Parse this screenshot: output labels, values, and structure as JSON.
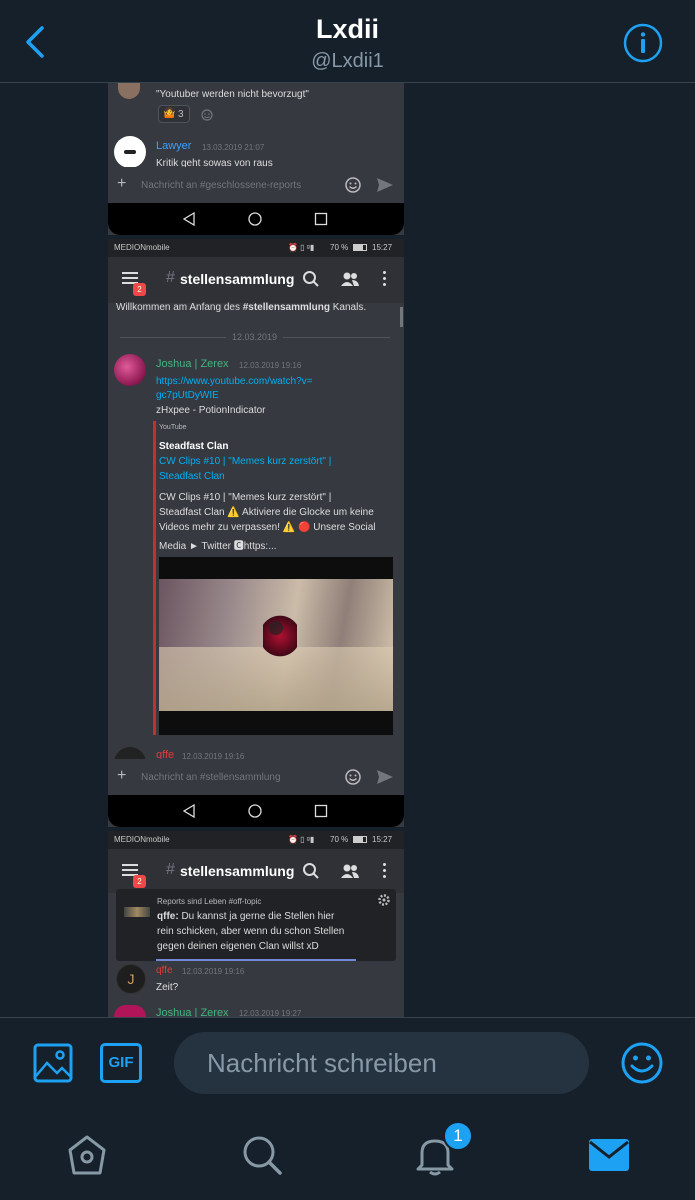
{
  "header": {
    "title": "Lxdii",
    "handle": "@Lxdii1"
  },
  "shot": {
    "top": {
      "quote": "\"Youtuber werden nicht bevorzugt\"",
      "reaction_count": "3",
      "user": "Lawyer",
      "time": "13.03.2019 21:07",
      "text": "Kritik geht sowas von raus",
      "input_placeholder": "Nachricht an #geschlossene-reports"
    },
    "status1": {
      "carrier": "MEDIONmobile",
      "battery": "70 %",
      "time": "15:27"
    },
    "channel1": {
      "name": "stellensammlung",
      "badge": "2",
      "welcome_pre": "Willkommen am Anfang des ",
      "welcome_channel": "#stellensammlung",
      "welcome_post": " Kanals.",
      "date_divider": "12.03.2019",
      "user": "Joshua | Zerex",
      "time": "12.03.2019 19:16",
      "link1": "https://www.youtube.com/watch?v=",
      "link2": "gc7pUtDyWIE",
      "text": "zHxpee - PotionIndicator",
      "embed_provider": "YouTube",
      "embed_author": "Steadfast Clan",
      "embed_title1": "CW Clips #10 | \"Memes kurz zerstört\" |",
      "embed_title2": "Steadfast Clan",
      "embed_desc1": "CW Clips #10 | \"Memes kurz zerstört\" |",
      "embed_desc2": "Steadfast Clan ⚠️ Aktiviere die Glocke um keine",
      "embed_desc3": "Videos mehr zu verpassen! ⚠️ 🔴 Unsere Social",
      "embed_desc4": "Media ► Twitter 🅲https:...",
      "next_user": "qffe",
      "next_time": "12.03.2019 19:16",
      "input_placeholder": "Nachricht an #stellensammlung"
    },
    "status2": {
      "carrier": "MEDIONmobile",
      "battery": "70 %",
      "time": "15:27"
    },
    "channel2": {
      "name": "stellensammlung",
      "badge": "2",
      "notif_source": "Reports sind Leben  #off-topic",
      "notif_user": "qffe:",
      "notif_text1": " Du kannst ja gerne die Stellen hier",
      "notif_text2": "rein schicken, aber wenn du schon Stellen",
      "notif_text3": "gegen deinen eigenen Clan willst xD",
      "user": "qffe",
      "time": "12.03.2019 19:16",
      "text": "Zeit?",
      "next_user": "Joshua | Zerex",
      "next_time": "12.03.2019 19:27"
    }
  },
  "composer": {
    "placeholder": "Nachricht schreiben",
    "gif_label": "GIF"
  },
  "nav": {
    "notification_count": "1"
  },
  "colors": {
    "accent": "#1da1f2",
    "background": "#15202b",
    "muted": "#8899a6"
  }
}
